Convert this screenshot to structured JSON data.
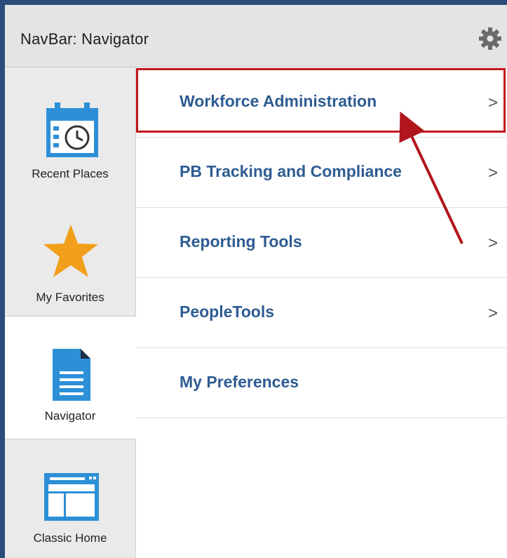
{
  "header": {
    "title": "NavBar: Navigator",
    "settings_icon": "gear-icon"
  },
  "sidebar": {
    "items": [
      {
        "label": "Recent Places",
        "icon": "calendar-clock-icon",
        "active": false
      },
      {
        "label": "My Favorites",
        "icon": "star-icon",
        "active": false
      },
      {
        "label": "Navigator",
        "icon": "document-icon",
        "active": true
      },
      {
        "label": "Classic Home",
        "icon": "window-icon",
        "active": false
      }
    ]
  },
  "menu": {
    "items": [
      {
        "label": "Workforce Administration",
        "has_submenu": true,
        "chevron": ">",
        "highlighted": true
      },
      {
        "label": "PB Tracking and Compliance",
        "has_submenu": true,
        "chevron": ">"
      },
      {
        "label": "Reporting Tools",
        "has_submenu": true,
        "chevron": ">"
      },
      {
        "label": "PeopleTools",
        "has_submenu": true,
        "chevron": ">"
      },
      {
        "label": "My Preferences",
        "has_submenu": false
      }
    ]
  },
  "colors": {
    "frame": "#2b4d7a",
    "link": "#2e5c92",
    "highlight": "#c4151c",
    "icon_blue": "#2d8fd6",
    "star": "#f2a01c"
  }
}
